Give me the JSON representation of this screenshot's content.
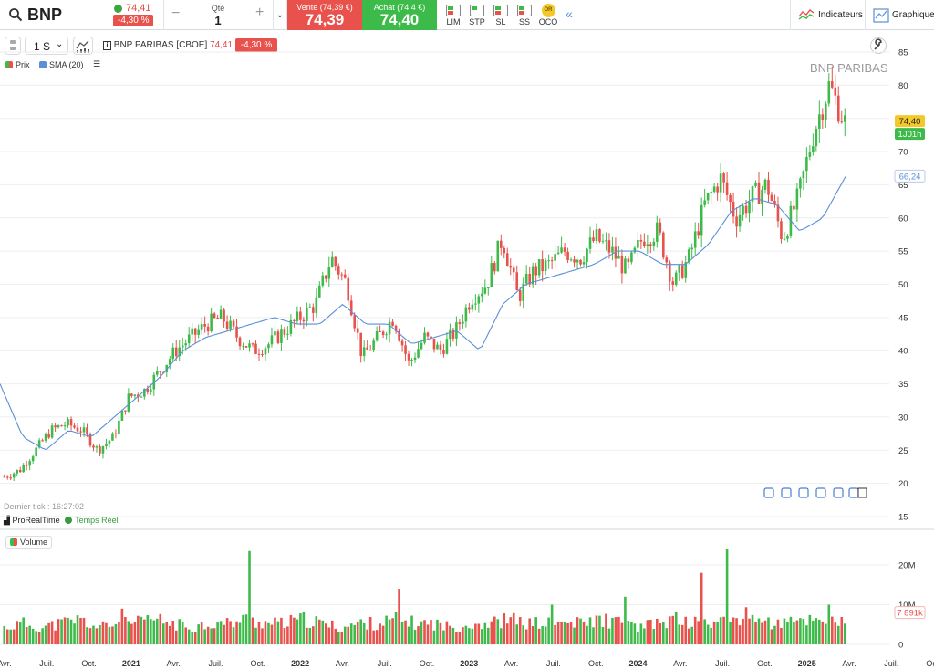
{
  "header": {
    "symbol": "BNP",
    "last_price": "74,41",
    "change_pct": "-4,30 %",
    "qty_label": "Qté",
    "qty_value": "1",
    "qty_minus": "−",
    "qty_plus": "+",
    "sell_label": "Vente (74,39 €)",
    "sell_price": "74,39",
    "buy_label": "Achat (74,4 €)",
    "buy_price": "74,40",
    "order_types": [
      "LIM",
      "STP",
      "SL",
      "SS",
      "OCO"
    ],
    "oco_badge": "OR",
    "indicators_label": "Indicateurs",
    "graph_label": "Graphique"
  },
  "toolbar": {
    "period": "1 S",
    "instrument": "BNP PARIBAS [CBOE]",
    "instrument_price": "74,41",
    "instrument_change": "-4,30 %"
  },
  "legend": {
    "price": "Prix",
    "sma": "SMA (20)",
    "volume": "Volume"
  },
  "watermark": "BNP PARIBAS",
  "last_tick": "Dernier tick : 16:27:02",
  "provider": "ProRealTime",
  "realtime": "Temps Réel",
  "colors": {
    "up": "#3dbb4a",
    "down": "#e8514c",
    "sma": "#5b8fd6"
  },
  "chart_data": {
    "type": "candlestick",
    "price_axis": {
      "ticks": [
        "85",
        "80",
        "75",
        "70",
        "65",
        "60",
        "55",
        "50",
        "45",
        "40",
        "35",
        "30",
        "25",
        "20",
        "15"
      ],
      "range": [
        15,
        85
      ]
    },
    "volume_axis": {
      "ticks": [
        "20M",
        "10M",
        "0"
      ],
      "range": [
        0,
        25
      ]
    },
    "x_labels": [
      "Avr.",
      "Juil.",
      "Oct.",
      "2021",
      "Avr.",
      "Juil.",
      "Oct.",
      "2022",
      "Avr.",
      "Juil.",
      "Oct.",
      "2023",
      "Avr.",
      "Juil.",
      "Oct.",
      "2024",
      "Avr.",
      "Juil.",
      "Oct.",
      "2025",
      "Avr.",
      "Juil.",
      "Oct."
    ],
    "price_labels": {
      "last": "74,40",
      "countdown": "1J01h",
      "sma": "66,24"
    },
    "volume_label": "7 891k",
    "close_anchors": [
      21,
      22,
      25,
      28,
      29,
      28,
      25,
      27,
      33,
      34,
      37,
      40,
      42,
      44,
      45,
      42,
      40,
      41,
      43,
      45,
      47,
      54,
      50,
      39,
      42,
      45,
      38,
      42,
      40,
      43,
      48,
      50,
      57,
      48,
      52,
      53,
      55,
      54,
      57,
      55,
      52,
      57,
      58,
      50,
      54,
      62,
      66,
      60,
      63,
      65,
      57,
      63,
      73,
      80,
      74.4
    ],
    "sma_anchors": [
      35,
      27,
      25,
      28,
      27,
      30,
      33,
      36,
      40,
      42,
      43,
      44,
      45,
      44,
      44,
      47,
      44,
      44,
      41,
      42,
      43,
      40,
      47,
      50,
      51,
      52,
      53,
      55,
      55,
      53,
      53,
      56,
      61,
      63,
      62,
      58,
      60,
      66.24
    ],
    "volume_anchors": [
      4,
      5,
      4,
      5,
      6,
      4,
      5,
      5,
      6,
      5,
      4,
      5,
      5,
      6,
      5,
      5,
      6,
      5,
      4,
      5,
      5,
      6,
      5,
      5,
      4,
      5,
      5,
      6,
      5,
      5,
      5,
      5,
      6,
      5,
      4,
      5,
      6,
      5,
      5,
      6,
      7,
      5,
      5,
      6,
      6,
      5
    ],
    "volume_spikes": [
      [
        0.14,
        9
      ],
      [
        0.29,
        23.5
      ],
      [
        0.47,
        14
      ],
      [
        0.74,
        12
      ],
      [
        0.86,
        24
      ],
      [
        0.83,
        18
      ],
      [
        0.65,
        10
      ],
      [
        0.98,
        10
      ]
    ]
  }
}
